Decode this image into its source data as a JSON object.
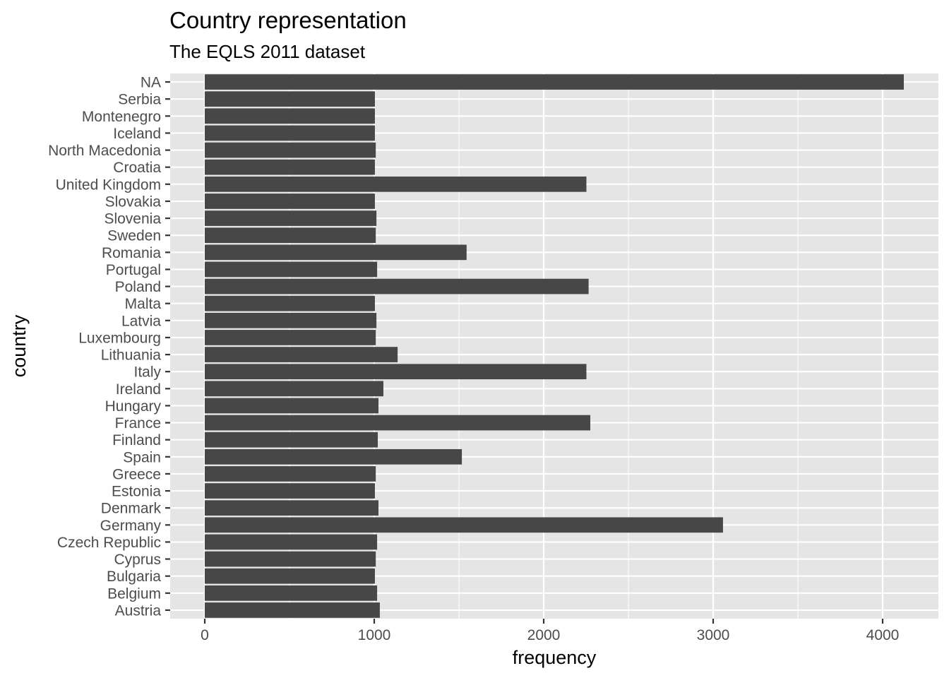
{
  "chart_data": {
    "type": "bar",
    "orientation": "horizontal",
    "title": "Country representation",
    "subtitle": "The EQLS 2011 dataset",
    "xlabel": "frequency",
    "ylabel": "country",
    "xlim": [
      -200,
      4330
    ],
    "xticks": [
      0,
      1000,
      2000,
      3000,
      4000
    ],
    "xtick_labels": [
      "0",
      "1000",
      "2000",
      "3000",
      "4000"
    ],
    "grid": true,
    "legend": "none",
    "colors": {
      "bar": "#474747",
      "panel": "#e5e5e5",
      "grid": "#ffffff",
      "tick_text": "#4d4d4d"
    },
    "categories": [
      "NA",
      "Serbia",
      "Montenegro",
      "Iceland",
      "North Macedonia",
      "Croatia",
      "United Kingdom",
      "Slovakia",
      "Slovenia",
      "Sweden",
      "Romania",
      "Portugal",
      "Poland",
      "Malta",
      "Latvia",
      "Luxembourg",
      "Lithuania",
      "Italy",
      "Ireland",
      "Hungary",
      "France",
      "Finland",
      "Spain",
      "Greece",
      "Estonia",
      "Denmark",
      "Germany",
      "Czech Republic",
      "Cyprus",
      "Bulgaria",
      "Belgium",
      "Austria"
    ],
    "values": [
      4125,
      1004,
      1004,
      1004,
      1009,
      1004,
      2252,
      1004,
      1013,
      1009,
      1545,
      1017,
      2265,
      1004,
      1013,
      1009,
      1138,
      2252,
      1054,
      1025,
      2275,
      1021,
      1517,
      1009,
      1004,
      1025,
      3058,
      1017,
      1009,
      1004,
      1017,
      1033
    ]
  }
}
